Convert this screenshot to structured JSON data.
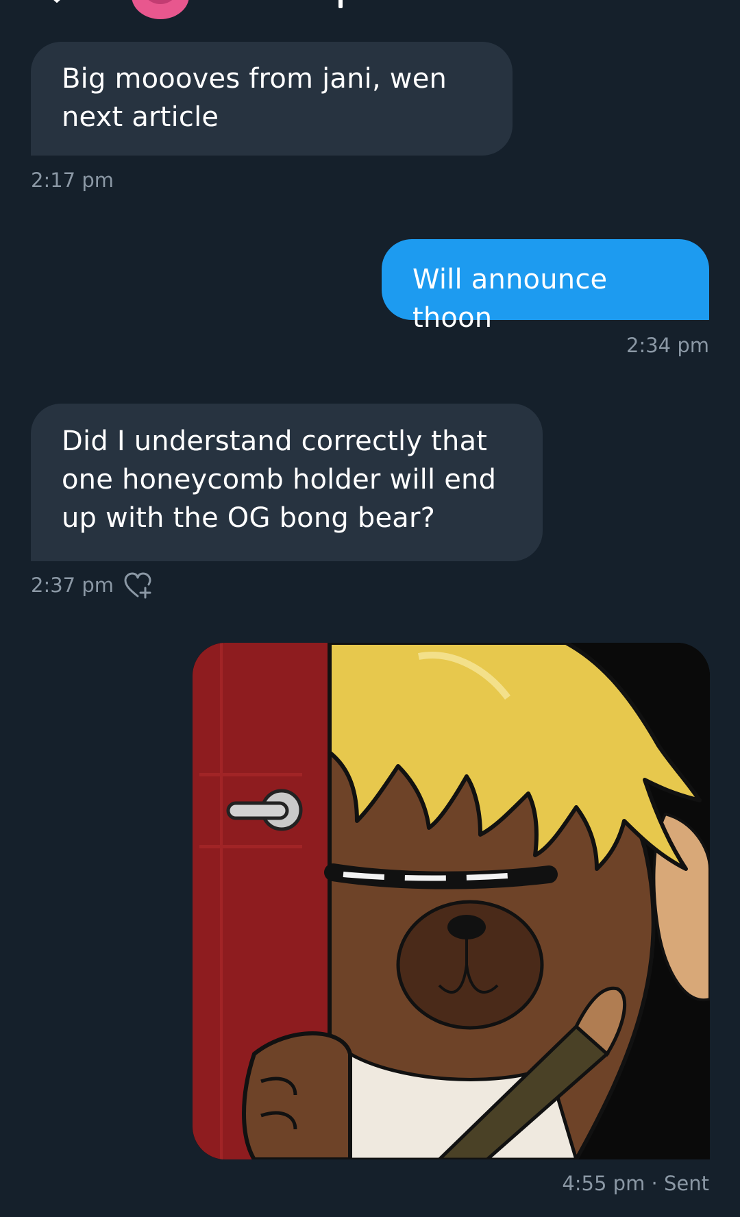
{
  "messages": [
    {
      "direction": "incoming",
      "text": "Big moooves from jani, wen next article",
      "time": "2:17 pm"
    },
    {
      "direction": "outgoing",
      "text": "Will announce thoon",
      "time": "2:34 pm"
    },
    {
      "direction": "incoming",
      "text": "Did I understand correctly that one honeycomb holder will end up with the OG bong bear?",
      "time": "2:37 pm"
    },
    {
      "direction": "outgoing",
      "type": "image",
      "image_icon": "bear-with-door-illustration",
      "time": "4:55 pm",
      "status": "Sent",
      "status_sep": " · "
    }
  ],
  "icons": [
    "back-arrow-icon",
    "avatar",
    "info-icon",
    "heart-plus-icon"
  ],
  "colors": {
    "background": "#15202b",
    "incoming_bubble": "#273340",
    "outgoing_bubble": "#1d9bf0",
    "timestamp": "#8b98a5"
  }
}
